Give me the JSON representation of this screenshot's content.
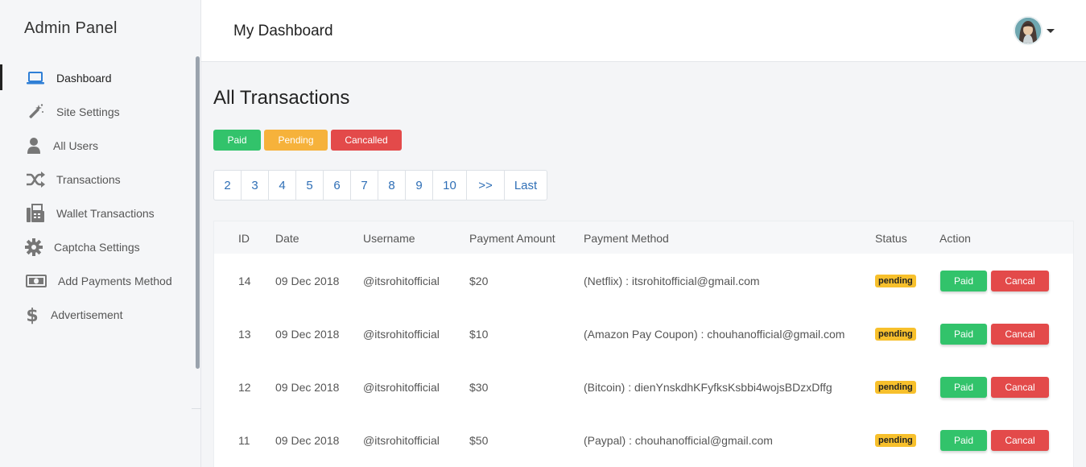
{
  "sidebar": {
    "brand": "Admin Panel",
    "items": [
      {
        "label": "Dashboard",
        "icon": "laptop-icon",
        "active": true
      },
      {
        "label": "Site Settings",
        "icon": "magic-wand-icon",
        "active": false
      },
      {
        "label": "All Users",
        "icon": "user-icon",
        "active": false
      },
      {
        "label": "Transactions",
        "icon": "shuffle-icon",
        "active": false
      },
      {
        "label": "Wallet Transactions",
        "icon": "fax-icon",
        "active": false
      },
      {
        "label": "Captcha Settings",
        "icon": "gear-icon",
        "active": false
      },
      {
        "label": "Add Payments Method",
        "icon": "money-bill-icon",
        "active": false
      },
      {
        "label": "Advertisement",
        "icon": "dollar-icon",
        "active": false
      }
    ]
  },
  "topbar": {
    "title": "My Dashboard",
    "avatar_icon": "user-avatar",
    "dropdown_icon": "caret-down-icon"
  },
  "main": {
    "heading": "All Transactions",
    "filters": {
      "paid": "Paid",
      "pending": "Pending",
      "cancelled": "Cancalled"
    },
    "pagination": [
      "2",
      "3",
      "4",
      "5",
      "6",
      "7",
      "8",
      "9",
      "10",
      ">>",
      "Last"
    ]
  },
  "table": {
    "headers": {
      "id": "ID",
      "date": "Date",
      "username": "Username",
      "amount": "Payment Amount",
      "method": "Payment Method",
      "status": "Status",
      "action": "Action"
    },
    "rows": [
      {
        "id": "14",
        "date": "09 Dec 2018",
        "username": "@itsrohitofficial",
        "amount": "$20",
        "method": "(Netflix) : itsrohitofficial@gmail.com",
        "status": "pending",
        "paid_label": "Paid",
        "cancel_label": "Cancal"
      },
      {
        "id": "13",
        "date": "09 Dec 2018",
        "username": "@itsrohitofficial",
        "amount": "$10",
        "method": "(Amazon Pay Coupon) : chouhanofficial@gmail.com",
        "status": "pending",
        "paid_label": "Paid",
        "cancel_label": "Cancal"
      },
      {
        "id": "12",
        "date": "09 Dec 2018",
        "username": "@itsrohitofficial",
        "amount": "$30",
        "method": "(Bitcoin) : dienYnskdhKFyfksKsbbi4wojsBDzxDffg",
        "status": "pending",
        "paid_label": "Paid",
        "cancel_label": "Cancal"
      },
      {
        "id": "11",
        "date": "09 Dec 2018",
        "username": "@itsrohitofficial",
        "amount": "$50",
        "method": "(Paypal) : chouhanofficial@gmail.com",
        "status": "pending",
        "paid_label": "Paid",
        "cancel_label": "Cancal"
      }
    ]
  },
  "colors": {
    "paid": "#32c36b",
    "pending": "#f6b23b",
    "cancel": "#e34a4a",
    "link": "#2f6fb6",
    "active_icon": "#2f7fd6"
  }
}
